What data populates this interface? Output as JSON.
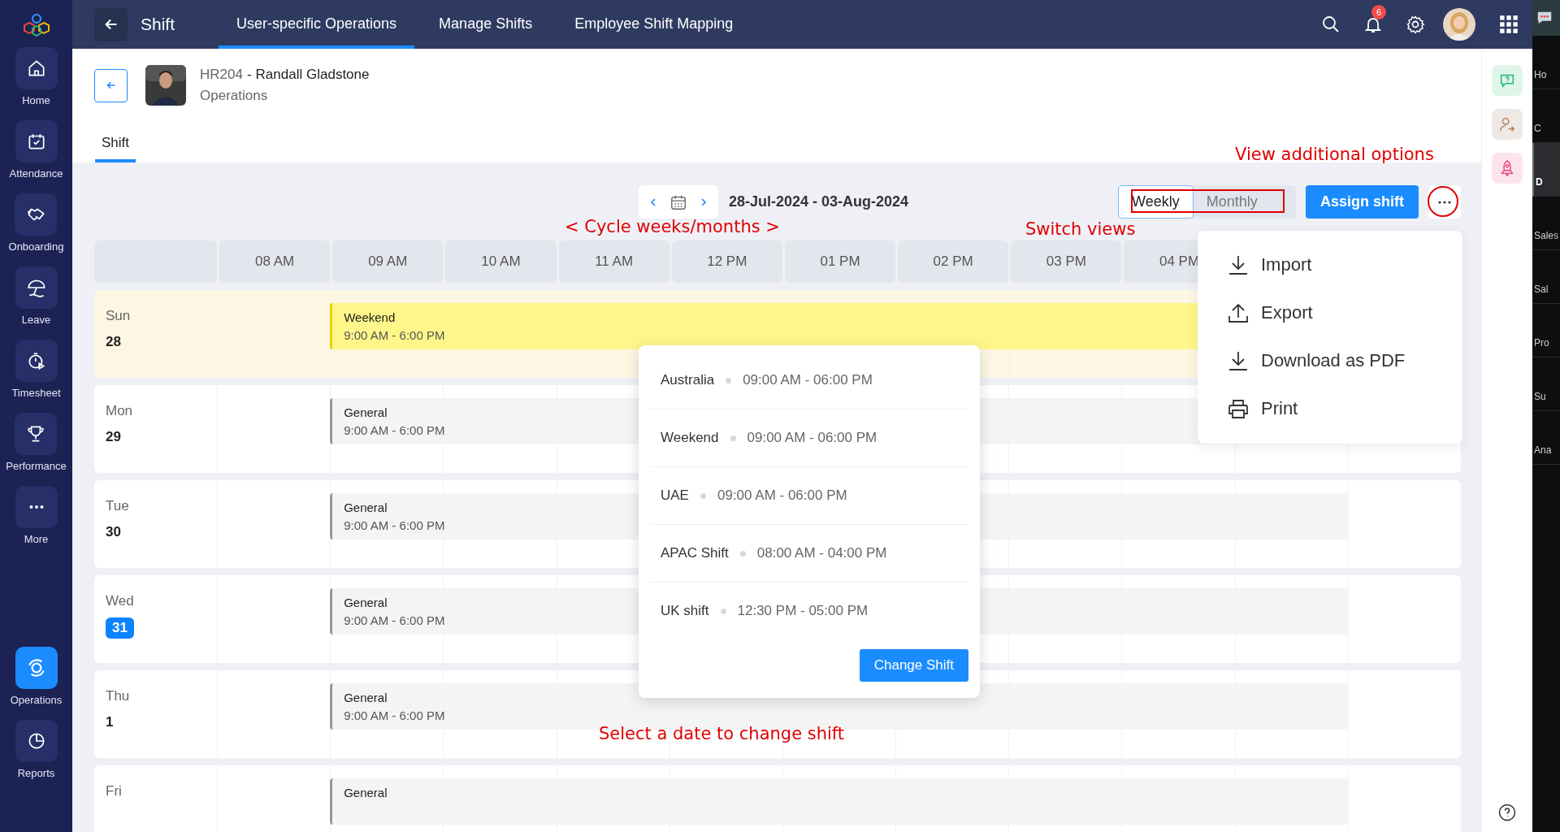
{
  "sidebar": {
    "items": [
      {
        "label": "Home",
        "kind": "home",
        "selected": false
      },
      {
        "label": "Attendance",
        "kind": "calendar",
        "selected": false
      },
      {
        "label": "Onboarding",
        "kind": "handshake",
        "selected": false
      },
      {
        "label": "Leave",
        "kind": "umbrella",
        "selected": false
      },
      {
        "label": "Timesheet",
        "kind": "timer",
        "selected": false
      },
      {
        "label": "Performance",
        "kind": "trophy",
        "selected": false
      },
      {
        "label": "More",
        "kind": "more",
        "selected": false
      },
      {
        "label": "Operations",
        "kind": "operations",
        "selected": true
      },
      {
        "label": "Reports",
        "kind": "pie",
        "selected": false
      }
    ]
  },
  "topbar": {
    "title": "Shift",
    "tabs": [
      {
        "label": "User-specific Operations",
        "selected": true
      },
      {
        "label": "Manage Shifts",
        "selected": false
      },
      {
        "label": "Employee Shift Mapping",
        "selected": false
      }
    ],
    "notification_count": "6"
  },
  "employee": {
    "id": "HR204",
    "separator": "-",
    "name": "Randall Gladstone",
    "department": "Operations"
  },
  "page_tabs": [
    {
      "label": "Shift",
      "selected": true
    }
  ],
  "toolbar": {
    "date_range": "28-Jul-2024 - 03-Aug-2024",
    "views": [
      {
        "label": "Weekly",
        "selected": true
      },
      {
        "label": "Monthly",
        "selected": false
      }
    ],
    "assign_button": "Assign shift"
  },
  "schedule": {
    "hours": [
      "08 AM",
      "09 AM",
      "10 AM",
      "11 AM",
      "12 PM",
      "01 PM",
      "02 PM",
      "03 PM",
      "04 PM"
    ],
    "days": [
      {
        "day": "Sun",
        "date": "28",
        "weekend": true,
        "today": false,
        "shift": {
          "kind": "weekend",
          "name": "Weekend",
          "time": "9:00 AM - 6:00 PM"
        }
      },
      {
        "day": "Mon",
        "date": "29",
        "weekend": false,
        "today": false,
        "shift": {
          "kind": "general",
          "name": "General",
          "time": "9:00 AM - 6:00 PM"
        }
      },
      {
        "day": "Tue",
        "date": "30",
        "weekend": false,
        "today": false,
        "shift": {
          "kind": "general",
          "name": "General",
          "time": "9:00 AM - 6:00 PM"
        }
      },
      {
        "day": "Wed",
        "date": "31",
        "weekend": false,
        "today": true,
        "shift": {
          "kind": "general",
          "name": "General",
          "time": "9:00 AM - 6:00 PM"
        }
      },
      {
        "day": "Thu",
        "date": "1",
        "weekend": false,
        "today": false,
        "shift": {
          "kind": "general",
          "name": "General",
          "time": "9:00 AM - 6:00 PM"
        }
      },
      {
        "day": "Fri",
        "weekend": false,
        "shift": {
          "kind": "general",
          "name": "General"
        }
      }
    ]
  },
  "change_shift_popup": {
    "options": [
      {
        "name": "Australia",
        "time": "09:00 AM - 06:00 PM"
      },
      {
        "name": "Weekend",
        "time": "09:00 AM - 06:00 PM"
      },
      {
        "name": "UAE",
        "time": "09:00 AM - 06:00 PM"
      },
      {
        "name": "APAC Shift",
        "time": "08:00 AM - 04:00 PM"
      },
      {
        "name": "UK shift",
        "time": "12:30 PM - 05:00 PM"
      }
    ],
    "button": "Change Shift"
  },
  "more_menu": [
    {
      "label": "Import",
      "kind": "import"
    },
    {
      "label": "Export",
      "kind": "export"
    },
    {
      "label": "Download as PDF",
      "kind": "download"
    },
    {
      "label": "Print",
      "kind": "print"
    }
  ],
  "annotations": [
    {
      "text": "View additional options"
    },
    {
      "text": "< Cycle weeks/months >"
    },
    {
      "text": "Switch views"
    },
    {
      "text": "Select a date to change shift"
    }
  ],
  "side_panel": {
    "items": [
      {
        "label": "Ho",
        "selected": false
      },
      {
        "label": "C",
        "selected": false
      },
      {
        "label": "D",
        "selected": true
      },
      {
        "label": "Sales",
        "selected": false
      },
      {
        "label": "Sal",
        "selected": false
      },
      {
        "label": "Pro",
        "selected": false
      },
      {
        "label": "Su",
        "selected": false
      },
      {
        "label": "Ana",
        "selected": false
      }
    ]
  }
}
